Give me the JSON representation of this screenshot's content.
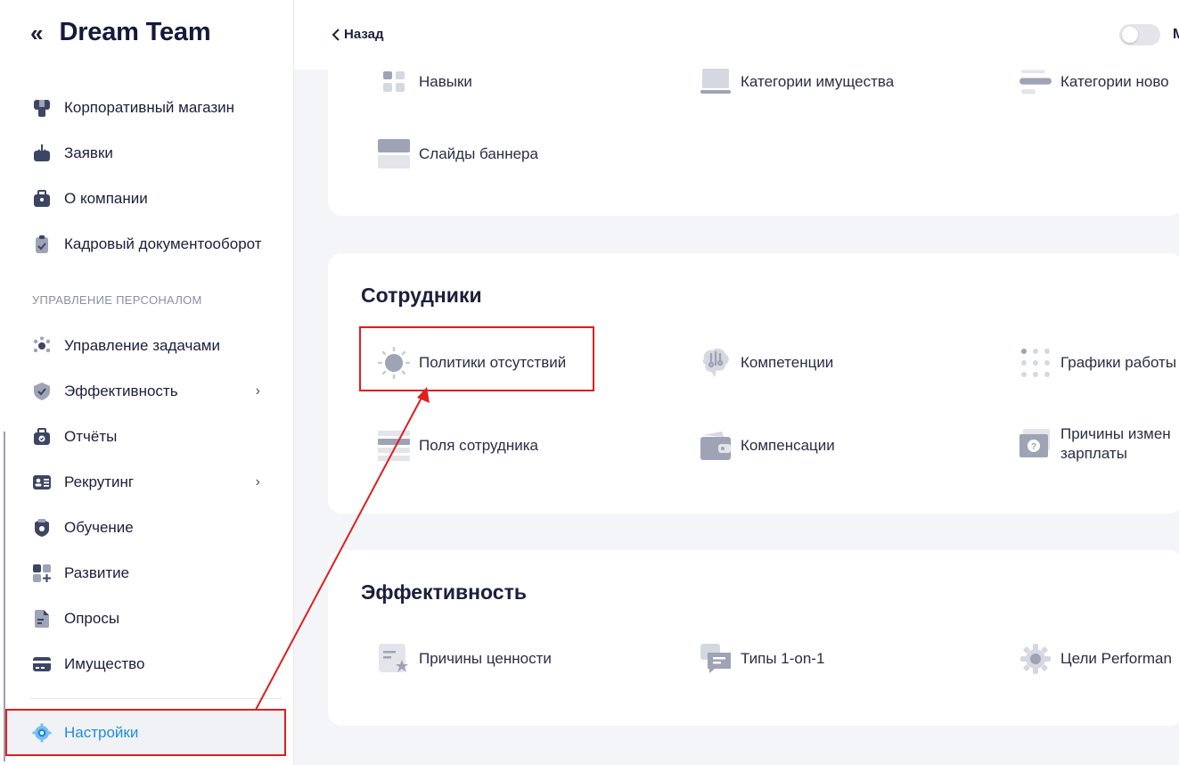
{
  "sidebar": {
    "brand": "Dream Team",
    "collapse_icon": "double-chevron-left-icon",
    "items_top": [
      {
        "label": "Корпоративный магазин",
        "icon": "shop-icon"
      },
      {
        "label": "Заявки",
        "icon": "inbox-icon"
      },
      {
        "label": "О компании",
        "icon": "briefcase-icon"
      },
      {
        "label": "Кадровый документооборот",
        "icon": "clipboard-check-icon"
      }
    ],
    "section_label": "УПРАВЛЕНИЕ ПЕРСОНАЛОМ",
    "items_hr": [
      {
        "label": "Управление задачами",
        "icon": "team-icon"
      },
      {
        "label": "Эффективность",
        "icon": "shield-check-icon",
        "chevron": "›"
      },
      {
        "label": "Отчёты",
        "icon": "report-icon"
      },
      {
        "label": "Рекрутинг",
        "icon": "id-card-icon",
        "chevron": "›"
      },
      {
        "label": "Обучение",
        "icon": "award-icon"
      },
      {
        "label": "Развитие",
        "icon": "grid-plus-icon"
      },
      {
        "label": "Опросы",
        "icon": "document-icon"
      },
      {
        "label": "Имущество",
        "icon": "card-icon"
      }
    ],
    "settings": {
      "label": "Настройки",
      "icon": "gear-icon",
      "active": true
    }
  },
  "topbar": {
    "back_label": "Назад",
    "toggle_text": "М"
  },
  "cards": {
    "top": {
      "tiles": [
        {
          "label": "Навыки",
          "icon": "grid-squares-icon"
        },
        {
          "label": "Категории имущества",
          "icon": "laptop-icon"
        },
        {
          "label": "Категории ново",
          "icon": "lines-icon"
        },
        {
          "label": "Слайды баннера",
          "icon": "banner-icon"
        }
      ]
    },
    "employees": {
      "title": "Сотрудники",
      "tiles": [
        {
          "label": "Политики отсутствий",
          "icon": "sun-icon"
        },
        {
          "label": "Компетенции",
          "icon": "brain-icon"
        },
        {
          "label": "Графики работы",
          "icon": "dots-grid-icon"
        },
        {
          "label": "Поля сотрудника",
          "icon": "form-lines-icon"
        },
        {
          "label": "Компенсации",
          "icon": "wallet-icon"
        },
        {
          "label": "Причины измен зарплаты",
          "icon": "money-question-icon"
        }
      ]
    },
    "efficiency": {
      "title": "Эффективность",
      "tiles": [
        {
          "label": "Причины ценности",
          "icon": "note-star-icon"
        },
        {
          "label": "Типы 1-on-1",
          "icon": "chat-icon"
        },
        {
          "label": "Цели Performan",
          "icon": "gear-icon"
        }
      ]
    }
  },
  "colors": {
    "accent": "#1e8ee0",
    "annotation": "#e01e1e",
    "icon_gray": "#9ea3b5",
    "sidebar_icon": "#3d4563"
  }
}
